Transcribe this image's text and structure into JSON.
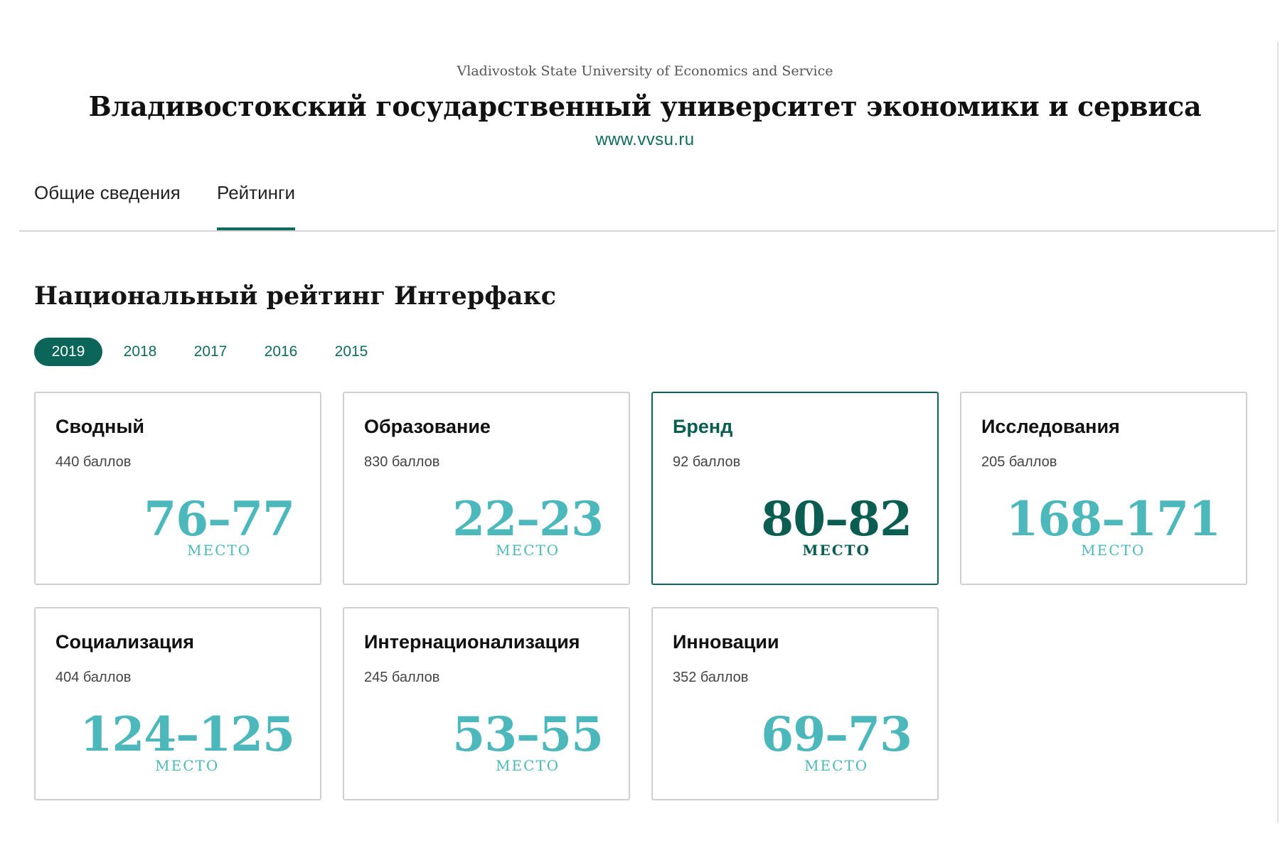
{
  "header": {
    "subtitle": "Vladivostok State University of Economics and Service",
    "title": "Владивостокский государственный университет экономики и сервиса",
    "site": "www.vvsu.ru"
  },
  "tabs": [
    {
      "label": "Общие сведения",
      "active": false
    },
    {
      "label": "Рейтинги",
      "active": true
    }
  ],
  "section": {
    "title": "Национальный рейтинг Интерфакс"
  },
  "years": [
    {
      "label": "2019",
      "active": true
    },
    {
      "label": "2018",
      "active": false
    },
    {
      "label": "2017",
      "active": false
    },
    {
      "label": "2016",
      "active": false
    },
    {
      "label": "2015",
      "active": false
    }
  ],
  "cards": [
    {
      "title": "Сводный",
      "score": "440 баллов",
      "rank": "76–77",
      "rank_label": "МЕСТО",
      "highlighted": false
    },
    {
      "title": "Образование",
      "score": "830 баллов",
      "rank": "22–23",
      "rank_label": "МЕСТО",
      "highlighted": false
    },
    {
      "title": "Бренд",
      "score": "92 баллов",
      "rank": "80–82",
      "rank_label": "МЕСТО",
      "highlighted": true
    },
    {
      "title": "Исследования",
      "score": "205 баллов",
      "rank": "168–171",
      "rank_label": "МЕСТО",
      "highlighted": false
    },
    {
      "title": "Социализация",
      "score": "404 баллов",
      "rank": "124–125",
      "rank_label": "МЕСТО",
      "highlighted": false
    },
    {
      "title": "Интернационализация",
      "score": "245 баллов",
      "rank": "53–55",
      "rank_label": "МЕСТО",
      "highlighted": false
    },
    {
      "title": "Инновации",
      "score": "352 баллов",
      "rank": "69–73",
      "rank_label": "МЕСТО",
      "highlighted": false
    }
  ],
  "colors": {
    "accent": "#0b6559",
    "link": "#0f6b5e",
    "rank": "#4cb8bb",
    "rank_highlight": "#0b5d52"
  }
}
